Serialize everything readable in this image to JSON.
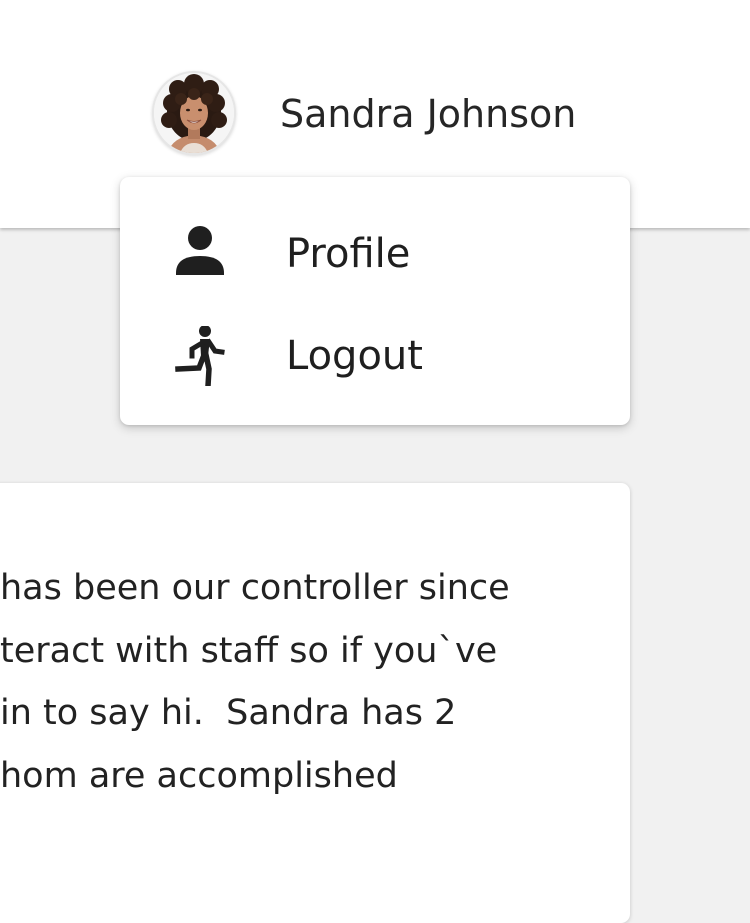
{
  "user": {
    "name": "Sandra Johnson",
    "avatar_icon": "user-photo-avatar"
  },
  "menu": {
    "items": [
      {
        "label": "Profile",
        "icon": "person-icon"
      },
      {
        "label": "Logout",
        "icon": "running-person-icon"
      }
    ]
  },
  "card": {
    "lines": [
      "has been our controller since",
      "teract with staff so if you`ve",
      "in to say hi.  Sandra has 2",
      "hom are accomplished"
    ]
  },
  "colors": {
    "background": "#f1f1f1",
    "surface": "#ffffff",
    "text": "#222222",
    "icon": "#1f1f1f"
  }
}
